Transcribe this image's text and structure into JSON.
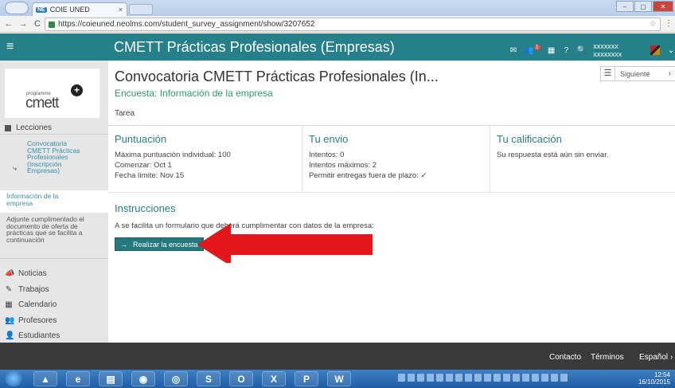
{
  "browser": {
    "tab_title": "COIE UNED",
    "tab_favicon": "NE",
    "tab_close": "×",
    "url": "https://coieuned.neolms.com/student_survey_assignment/show/3207652",
    "url_host_part": "https://coieuned.neolms.com",
    "back_icon": "←",
    "forward_icon": "→",
    "reload_icon": "C",
    "star_icon": "☆",
    "menu_icon": "⋮",
    "win_min": "–",
    "win_max": "▢",
    "win_close": "✕"
  },
  "header": {
    "menu_icon": "≡",
    "course_title": "CMETT Prácticas Profesionales (Empresas)",
    "notif_badge": "1",
    "username": "xxxxxxx xxxxxxxx",
    "icon_mail": "✉",
    "icon_people": "👥",
    "icon_calendar": "▦",
    "icon_help": "?",
    "icon_search": "🔍",
    "icon_dropdown": "⌄"
  },
  "sidebar": {
    "logo_small": "programme",
    "logo_main": "cmett",
    "logo_plus": "+",
    "heading": "Lecciones",
    "lesson_arrow": "⤷",
    "lesson": "Convocatoria CMETT Prácticas Profesionales (Inscripción Empresas)",
    "active_item": "Información de la empresa",
    "sub_item": "Adjunte cumplimentado el documento de oferta de prácticas que se facilita a continuación",
    "menu": [
      {
        "icon": "📣",
        "label": "Noticias"
      },
      {
        "icon": "✎",
        "label": "Trabajos"
      },
      {
        "icon": "▦",
        "label": "Calendario"
      },
      {
        "icon": "👥",
        "label": "Profesores"
      },
      {
        "icon": "👤",
        "label": "Estudiantes"
      }
    ]
  },
  "main": {
    "title": "Convocatoria CMETT Prácticas Profesionales (In...",
    "subtitle": "Encuesta: Información de la empresa",
    "next_list_icon": "☰",
    "next_label": "Siguiente",
    "next_chevron": "›",
    "tab": "Tarea",
    "puntuacion": {
      "title": "Puntuación",
      "lines": [
        "Máxima puntuación individual: 100",
        "Comenzar: Oct 1",
        "Fecha límite: Nov 15"
      ]
    },
    "envio": {
      "title": "Tu envio",
      "lines": [
        "Intentos: 0",
        "Intentos máximos: 2",
        "Permitir entregas fuera de plazo: ✓"
      ]
    },
    "calificacion": {
      "title": "Tu calificación",
      "lines": [
        "Su respuesta está aún sin enviar."
      ]
    },
    "instructions_title": "Instrucciones",
    "instructions_text": "A se facilita un formulario que deberá cumplimentar con datos de la empresa:",
    "start_button_icon": "→",
    "start_button": "Realizar la encuesta"
  },
  "footer": {
    "contact": "Contacto",
    "terms": "Términos",
    "language": "Español",
    "language_chevron": "›"
  },
  "taskbar": {
    "apps": [
      "▲",
      "e",
      "▤",
      "◉",
      "◎",
      "S",
      "O",
      "X",
      "P",
      "W"
    ],
    "time": "12:54",
    "date": "16/10/2015"
  },
  "colors": {
    "header": "#25808a",
    "accent_green": "#27a06a",
    "button": "#23797d",
    "arrow": "#e3161b"
  }
}
